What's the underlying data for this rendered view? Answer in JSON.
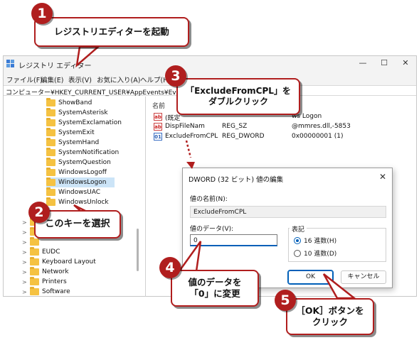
{
  "window": {
    "title": "レジストリ エディター",
    "controls": {
      "minimize": "—",
      "maximize": "☐",
      "close": "✕"
    },
    "menu": [
      "ファイル(F)",
      "編集(E)",
      "表示(V)",
      "お気に入り(A)",
      "ヘルプ(H)"
    ],
    "address": "コンピューター¥HKEY_CURRENT_USER¥AppEvents¥EventLabels¥"
  },
  "tree": {
    "event_keys": [
      "ShowBand",
      "SystemAsterisk",
      "SystemExclamation",
      "SystemExit",
      "SystemHand",
      "SystemNotification",
      "SystemQuestion",
      "WindowsLogoff",
      "WindowsLogon",
      "WindowsUAC",
      "WindowsUnlock"
    ],
    "selected": "WindowsLogon",
    "top_keys": [
      "EUDC",
      "Keyboard Layout",
      "Network",
      "Printers",
      "Software"
    ]
  },
  "values_pane": {
    "column_name": "名前",
    "rows": [
      {
        "icon": "ab",
        "name": "(既定",
        "type": "",
        "data": "ws Logon"
      },
      {
        "icon": "ab",
        "name": "DispFileNam",
        "type": "REG_SZ",
        "data": "@mmres.dll,-5853"
      },
      {
        "icon": "bin",
        "name": "ExcludeFromCPL",
        "type": "REG_DWORD",
        "data": "0x00000001 (1)"
      }
    ]
  },
  "dialog": {
    "title": "DWORD (32 ビット) 値の編集",
    "close": "✕",
    "name_label": "値の名前(N):",
    "name_value": "ExcludeFromCPL",
    "data_label": "値のデータ(V):",
    "data_value": "0",
    "base_label": "表記",
    "hex_label": "16 進数(H)",
    "dec_label": "10 進数(D)",
    "selected_base": "hex",
    "ok_label": "OK",
    "cancel_label": "キャンセル"
  },
  "annotations": [
    {
      "step": "1",
      "text": "レジストリエディターを起動"
    },
    {
      "step": "2",
      "text": "このキーを選択"
    },
    {
      "step": "3",
      "text": "「ExcludeFromCPL」を\nダブルクリック"
    },
    {
      "step": "4",
      "text": "値のデータを\n「0」に変更"
    },
    {
      "step": "5",
      "text": "［OK］ボタンを\nクリック"
    }
  ],
  "colors": {
    "accent": "#b01e1e",
    "selection": "#cce4f7",
    "focus_blue": "#005fb8",
    "folder": "#f5c242"
  }
}
